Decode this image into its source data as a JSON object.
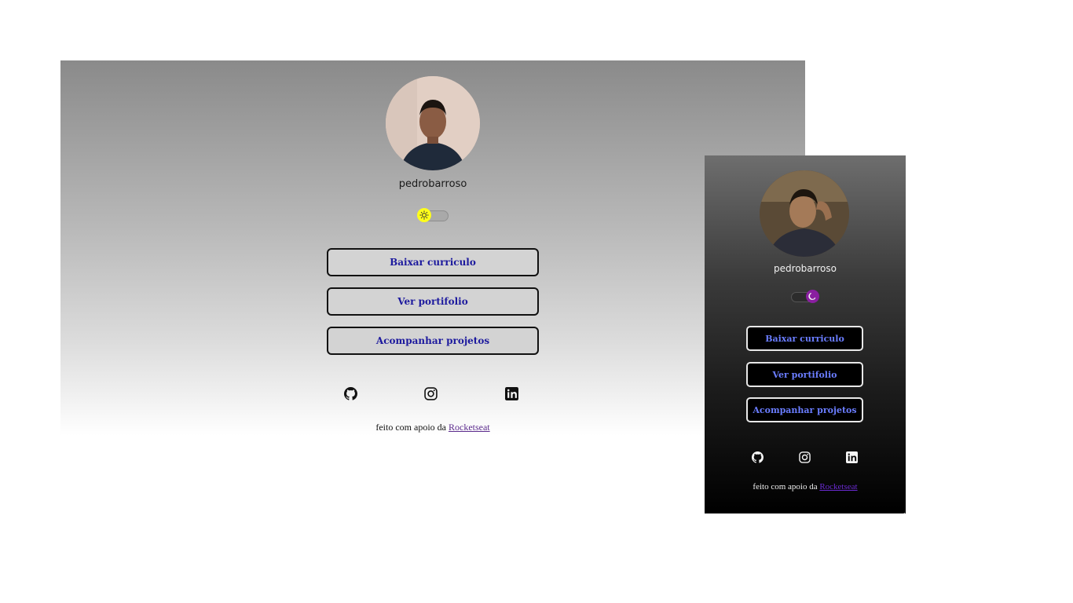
{
  "light_view": {
    "username": "pedrobarroso",
    "theme_toggle": {
      "state": "light",
      "icon": "sun-icon"
    },
    "buttons": [
      {
        "label": "Baixar curriculo"
      },
      {
        "label": "Ver portifolio"
      },
      {
        "label": "Acompanhar projetos"
      }
    ],
    "social": [
      "github-icon",
      "instagram-icon",
      "linkedin-icon"
    ],
    "footer": {
      "text": "feito com apoio da ",
      "link_label": "Rocketseat"
    }
  },
  "dark_view": {
    "username": "pedrobarroso",
    "theme_toggle": {
      "state": "dark",
      "icon": "moon-icon"
    },
    "buttons": [
      {
        "label": "Baixar curriculo"
      },
      {
        "label": "Ver portifolio"
      },
      {
        "label": "Acompanhar projetos"
      }
    ],
    "social": [
      "github-icon",
      "instagram-icon",
      "linkedin-icon"
    ],
    "footer": {
      "text": "feito com apoio da ",
      "link_label": "Rocketseat"
    }
  },
  "colors": {
    "light_button_text": "#1d1a9e",
    "dark_button_text": "#6a7dff",
    "sun_knob": "#ffff1a",
    "moon_knob": "#8a1fa0",
    "link_light": "#5b2a8c",
    "link_dark": "#6a2ad0"
  }
}
